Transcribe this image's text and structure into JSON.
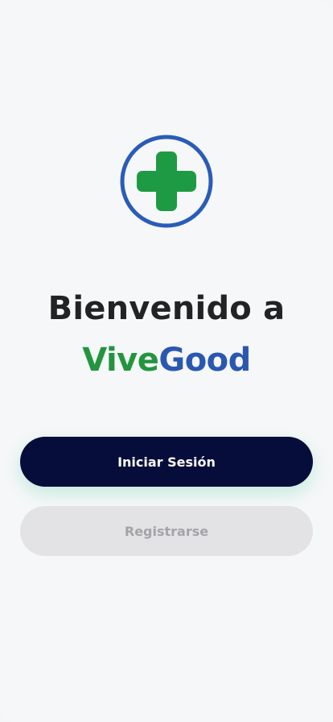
{
  "welcome": {
    "line1": "Bienvenido a",
    "brand_part1": "Vive",
    "brand_part2": "Good"
  },
  "actions": {
    "login_label": "Iniciar Sesión",
    "register_label": "Registrarse"
  },
  "logo": {
    "icon": "medical-cross-icon",
    "ring_color": "#2a5cb8",
    "cross_color": "#1f9a44"
  },
  "colors": {
    "brand_green": "#23953f",
    "brand_blue": "#2a57b0",
    "primary_button": "#070d3b",
    "secondary_button": "#e3e3e5"
  }
}
